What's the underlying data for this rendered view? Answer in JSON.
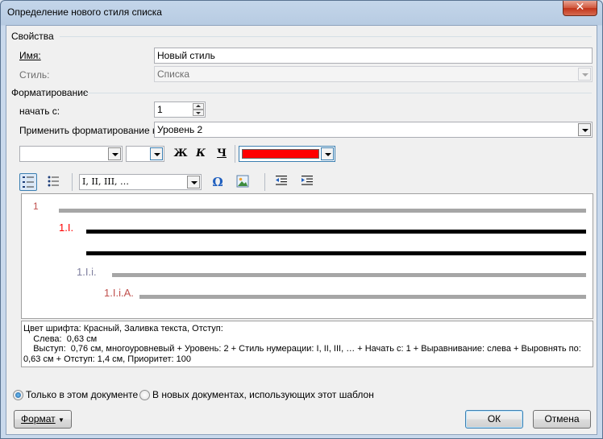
{
  "window": {
    "title": "Определение нового стиля списка",
    "close_glyph": "✕"
  },
  "properties": {
    "section": "Свойства",
    "name_label": "Имя:",
    "name_value": "Новый стиль",
    "style_label": "Стиль:",
    "style_value": "Списка"
  },
  "formatting": {
    "section": "Форматирование",
    "start_label": "начать с:",
    "start_value": "1",
    "apply_label": "Применить форматирование к:",
    "apply_value": "Уровень 2",
    "font_value": "",
    "size_value": "",
    "bold_glyph": "Ж",
    "italic_glyph": "К",
    "underline_glyph": "Ч",
    "font_color": "#ff0000",
    "numbering_value": "I, II, III, …",
    "symbol_glyph": "Ω"
  },
  "preview": {
    "level_labels": [
      "1",
      "1.I.",
      "1.I.i.",
      "1.I.i.A."
    ],
    "colors": {
      "level1": "#c0504d",
      "level2": "#ff0000",
      "level3": "#7f7f9f",
      "level4": "#c0504d"
    }
  },
  "description": {
    "lines": [
      "Цвет шрифта: Красный, Заливка текста, Отступ:",
      "    Слева:  0,63 см",
      "    Выступ:  0,76 см, многоуровневый + Уровень: 2 + Стиль нумерации: I, II, III, … + Начать с: 1 + Выравнивание: слева + Выровнять по:",
      "0,63 см + Отступ:  1,4 см, Приоритет: 100"
    ]
  },
  "scope": {
    "only_this_document": "Только в этом документе",
    "new_documents": "В новых документах, использующих этот шаблон"
  },
  "buttons": {
    "format": "Формат",
    "ok": "ОК",
    "cancel": "Отмена"
  }
}
